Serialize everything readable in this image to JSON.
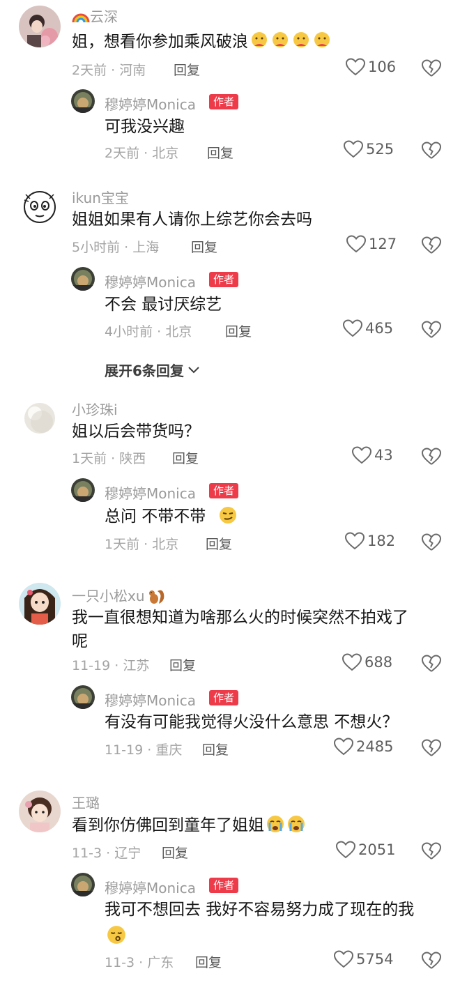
{
  "comments": [
    {
      "user": "云深",
      "text": "姐，想看你参加乘风破浪",
      "emoji": [
        "hug-face-icon",
        "hug-face-icon",
        "hug-face-icon",
        "hug-face-icon"
      ],
      "meta": "2天前 · 河南",
      "reply_label": "回复",
      "likes": "106",
      "author_reply": {
        "user": "穆婷婷Monica",
        "badge": "作者",
        "text": "可我没兴趣",
        "meta": "2天前 · 北京",
        "reply_label": "回复",
        "likes": "525"
      }
    },
    {
      "user": "ikun宝宝",
      "text": "姐姐如果有人请你上综艺你会去吗",
      "meta": "5小时前 · 上海",
      "reply_label": "回复",
      "likes": "127",
      "author_reply": {
        "user": "穆婷婷Monica",
        "badge": "作者",
        "text": "不会 最讨厌综艺",
        "meta": "4小时前 · 北京",
        "reply_label": "回复",
        "likes": "465"
      },
      "expand": "展开6条回复"
    },
    {
      "user": "小珍珠i",
      "text": "姐以后会带货吗？",
      "meta": "1天前 · 陕西",
      "reply_label": "回复",
      "likes": "43",
      "author_reply": {
        "user": "穆婷婷Monica",
        "badge": "作者",
        "text": "总问 不带不带",
        "emoji": [
          "smirk-face-icon"
        ],
        "meta": "1天前 · 北京",
        "reply_label": "回复",
        "likes": "182"
      }
    },
    {
      "user": "一只小松xu",
      "user_emoji": "squirrel-icon",
      "text_line1": "我一直很想知道为啥那么火的时候突然不拍戏了",
      "text_line2": "呢",
      "meta": "11-19 · 江苏",
      "reply_label": "回复",
      "likes": "688",
      "author_reply": {
        "user": "穆婷婷Monica",
        "badge": "作者",
        "text": "有没有可能我觉得火没什么意思 不想火？",
        "meta": "11-19 · 重庆",
        "reply_label": "回复",
        "likes": "2485"
      }
    },
    {
      "user": "王璐",
      "text": "看到你仿佛回到童年了姐姐",
      "emoji": [
        "crying-face-icon",
        "crying-face-icon"
      ],
      "meta": "11-3 · 辽宁",
      "reply_label": "回复",
      "likes": "2051",
      "author_reply": {
        "user": "穆婷婷Monica",
        "badge": "作者",
        "text": "我可不想回去 我好不容易努力成了现在的我",
        "emoji": [
          "kissing-face-icon"
        ],
        "meta": "11-3 · 广东",
        "reply_label": "回复",
        "likes": "5754"
      }
    }
  ],
  "colors": {
    "badge": "#ee3b4a",
    "meta": "#a3a3a3",
    "text": "#161616"
  }
}
